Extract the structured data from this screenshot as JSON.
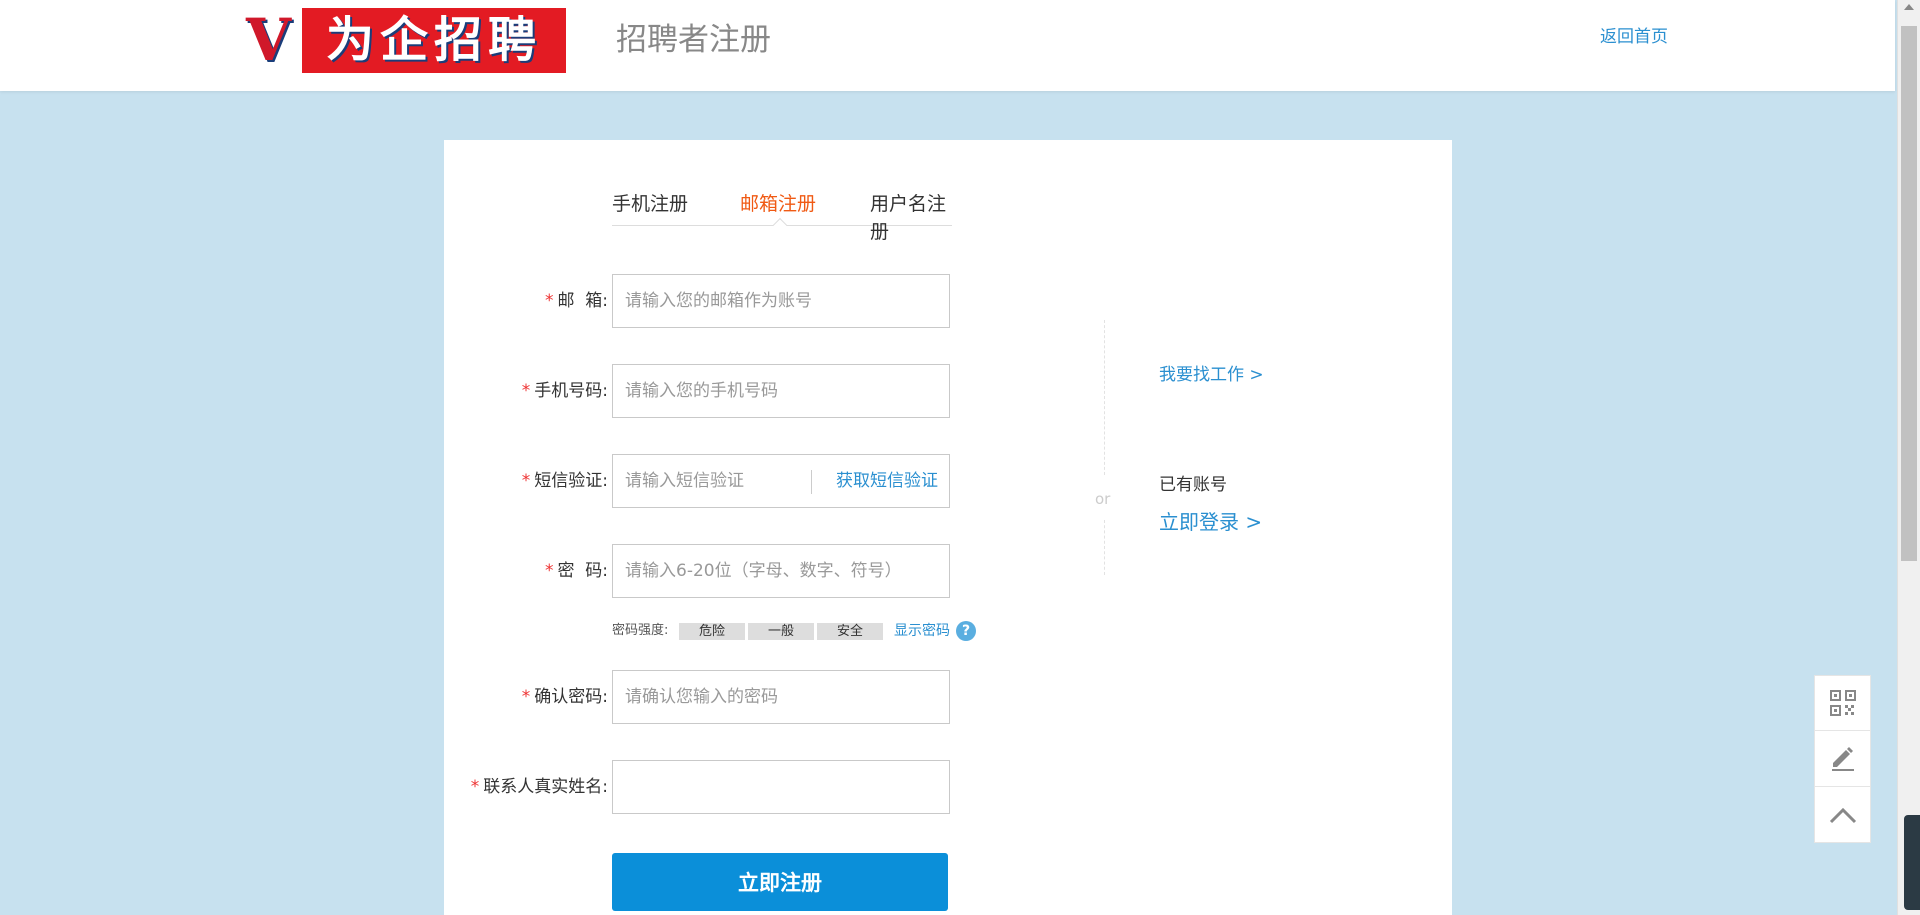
{
  "header": {
    "logo_letter": "V",
    "logo_text": "为企招聘",
    "title": "招聘者注册",
    "home_link": "返回首页"
  },
  "tabs": [
    {
      "label": "手机注册",
      "active": false
    },
    {
      "label": "邮箱注册",
      "active": true
    },
    {
      "label": "用户名注册",
      "active": false
    }
  ],
  "form": {
    "email": {
      "label": "邮  箱:",
      "placeholder": "请输入您的邮箱作为账号",
      "value": ""
    },
    "phone": {
      "label": "手机号码:",
      "placeholder": "请输入您的手机号码",
      "value": ""
    },
    "sms": {
      "label": "短信验证:",
      "placeholder": "请输入短信验证",
      "value": "",
      "get_code": "获取短信验证"
    },
    "password": {
      "label": "密  码:",
      "placeholder": "请输入6-20位（字母、数字、符号）",
      "value": ""
    },
    "strength": {
      "label": "密码强度:",
      "levels": [
        "危险",
        "一般",
        "安全"
      ],
      "show_password": "显示密码",
      "help": "?"
    },
    "confirm": {
      "label": "确认密码:",
      "placeholder": "请确认您输入的密码",
      "value": ""
    },
    "contact_name": {
      "label": "联系人真实姓名:",
      "placeholder": "",
      "value": ""
    },
    "required_mark": "*",
    "submit": "立即注册"
  },
  "side": {
    "find_job": "我要找工作 >",
    "or": "or",
    "have_account": "已有账号",
    "login_now": "立即登录 >"
  },
  "float_tools": [
    "qr-code-icon",
    "edit-icon",
    "back-to-top-icon"
  ],
  "colors": {
    "background": "#c7e1ef",
    "accent": "#0b8fd9",
    "link": "#2a8fd0",
    "active_tab": "#f05a14",
    "required": "#e33333",
    "logo_red": "#e31b23"
  }
}
